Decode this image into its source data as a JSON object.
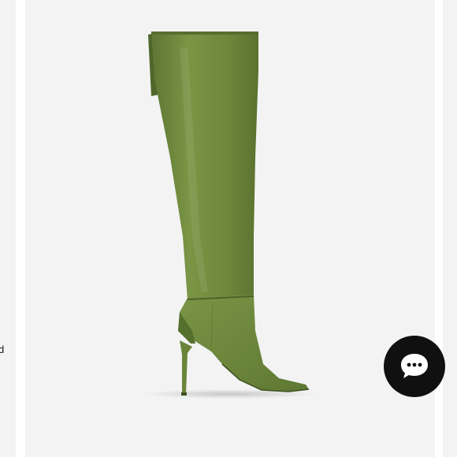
{
  "left_strip": {
    "edge_text": "d"
  },
  "product": {
    "image_name": "green-over-the-knee-stiletto-boot",
    "boot_color": "#6f8a3f",
    "panel_background": "#f3f3f3"
  },
  "chat": {
    "icon": "chat-bubble-ellipsis-icon",
    "background": "#101010",
    "icon_color": "#ffffff"
  }
}
